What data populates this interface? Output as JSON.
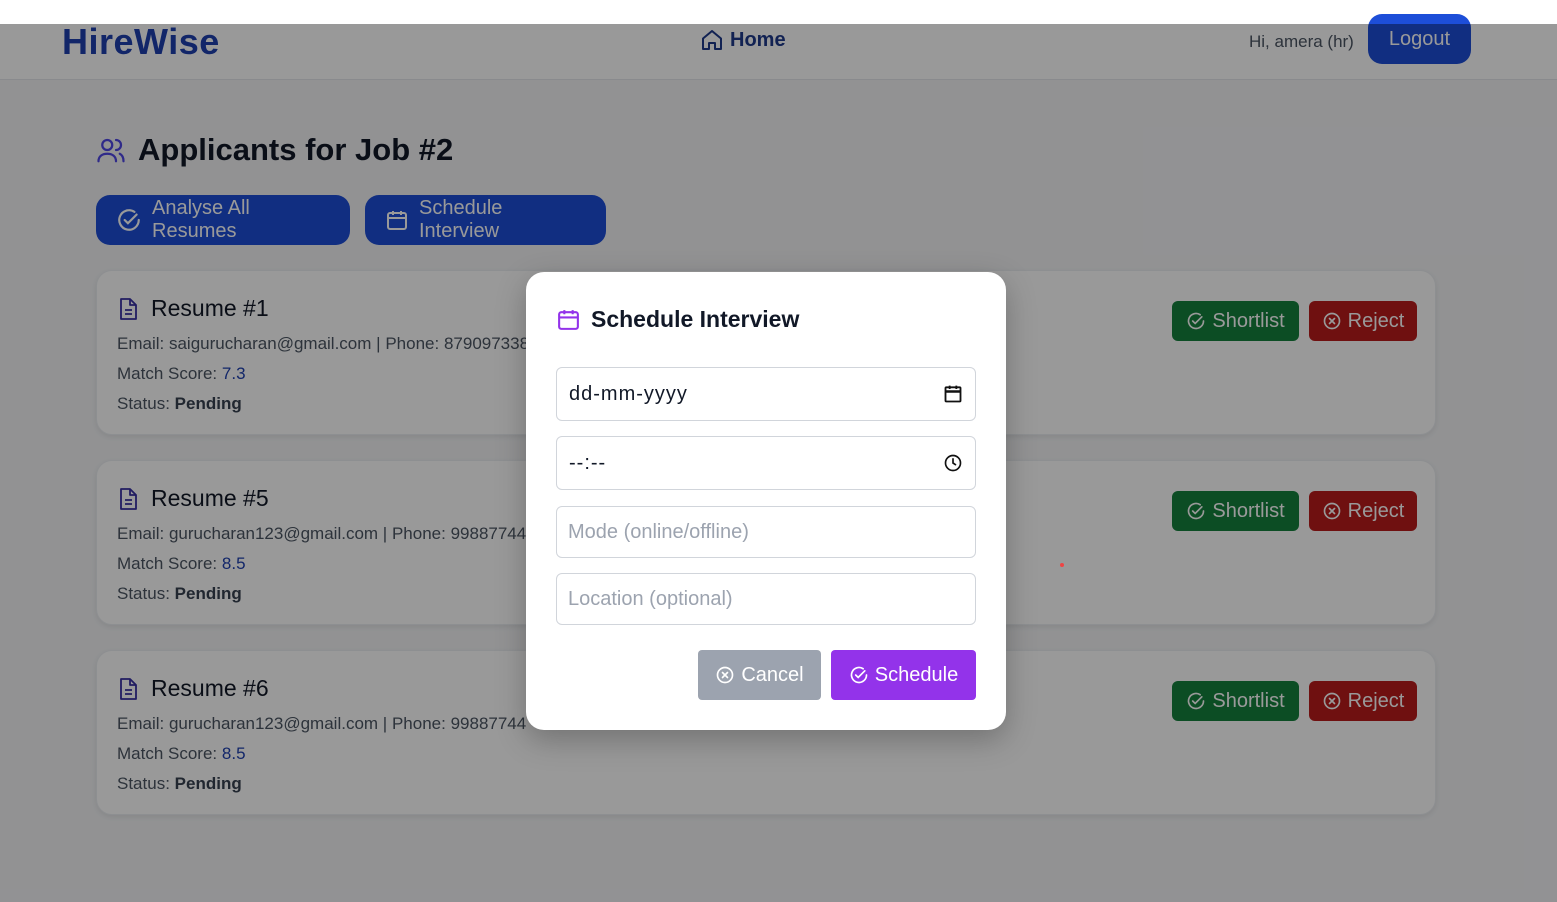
{
  "navbar": {
    "brand": "HireWise",
    "home_label": "Home",
    "greeting": "Hi, amera (hr)",
    "logout_label": "Logout"
  },
  "page": {
    "title": "Applicants for Job #2",
    "analyse_label": "Analyse All Resumes",
    "schedule_label": "Schedule Interview"
  },
  "labels": {
    "email": "Email:",
    "phone": "Phone:",
    "separator": "|",
    "match_score": "Match Score:",
    "status": "Status:",
    "shortlist": "Shortlist",
    "reject": "Reject"
  },
  "resumes": [
    {
      "title": "Resume #1",
      "email": "saigurucharan@gmail.com",
      "phone": "879097338",
      "score": "7.3",
      "status": "Pending"
    },
    {
      "title": "Resume #5",
      "email": "gurucharan123@gmail.com",
      "phone": "99887744",
      "score": "8.5",
      "status": "Pending"
    },
    {
      "title": "Resume #6",
      "email": "gurucharan123@gmail.com",
      "phone": "99887744",
      "score": "8.5",
      "status": "Pending"
    }
  ],
  "modal": {
    "title": "Schedule Interview",
    "date_value": "dd-mm-yyyy",
    "time_value": "--:--",
    "mode_placeholder": "Mode (online/offline)",
    "location_placeholder": "Location (optional)",
    "cancel_label": "Cancel",
    "submit_label": "Schedule"
  },
  "colors": {
    "brand": "#1e40af",
    "primary": "#1d4ed8",
    "success": "#15803d",
    "danger": "#b91c1c",
    "modal_accent": "#9333ea",
    "cancel": "#9ca3af"
  }
}
